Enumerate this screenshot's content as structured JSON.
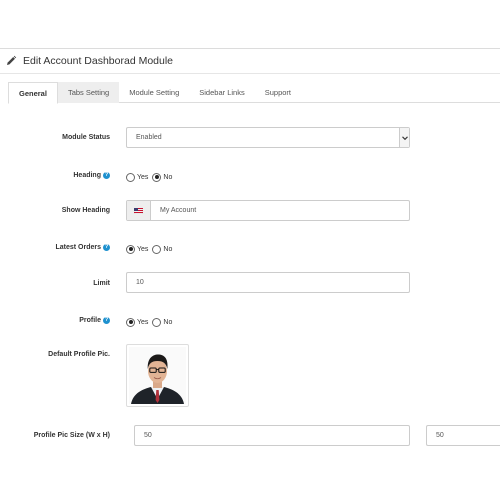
{
  "panel": {
    "title": "Edit Account Dashborad Module",
    "title_icon": "pencil-icon"
  },
  "tabs": [
    {
      "label": "General",
      "active": true
    },
    {
      "label": "Tabs Setting",
      "active": false
    },
    {
      "label": "Module Setting",
      "active": false
    },
    {
      "label": "Sidebar Links",
      "active": false
    },
    {
      "label": "Support",
      "active": false
    }
  ],
  "form": {
    "module_status": {
      "label": "Module Status",
      "value": "Enabled"
    },
    "heading": {
      "label": "Heading",
      "yes": "Yes",
      "no": "No",
      "selected": "No"
    },
    "show_heading": {
      "label": "Show Heading",
      "value": "My Account",
      "flag_icon": "flag-icon"
    },
    "latest_orders": {
      "label": "Latest Orders",
      "yes": "Yes",
      "no": "No",
      "selected": "Yes"
    },
    "limit": {
      "label": "Limit",
      "value": "10"
    },
    "profile": {
      "label": "Profile",
      "yes": "Yes",
      "no": "No",
      "selected": "Yes"
    },
    "default_profile_pic": {
      "label": "Default Profile Pic."
    },
    "profile_pic_size": {
      "label": "Profile Pic Size (W x H)",
      "width": "50",
      "height": "50"
    }
  },
  "colors": {
    "help_icon": "#1e91cf",
    "border": "#cccccc",
    "tab_hover": "#eeeeee"
  }
}
